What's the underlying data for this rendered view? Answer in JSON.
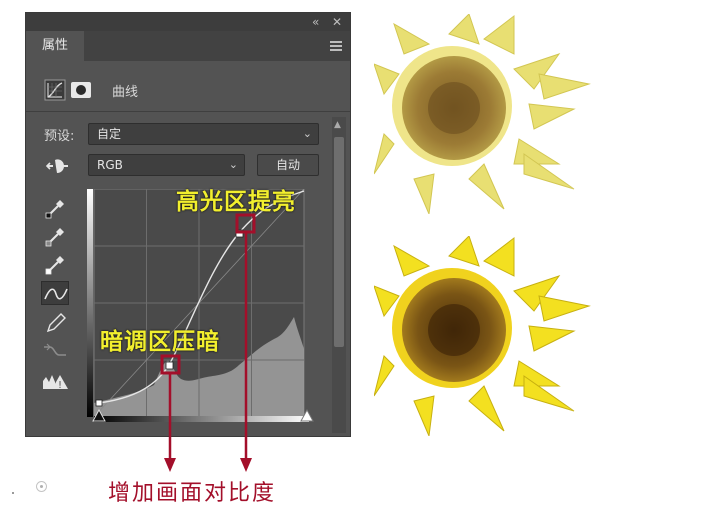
{
  "panel": {
    "tab_label": "属性",
    "collapse_icon": "double-chevron-left-icon",
    "close_icon": "close-icon",
    "menu_icon": "panel-menu-icon",
    "adjustment_label": "曲线",
    "preset_label": "预设:",
    "preset_value": "自定",
    "channel_value": "RGB",
    "auto_button": "自动"
  },
  "tools": [
    {
      "name": "on-image-adjust-icon"
    },
    {
      "name": "black-point-eyedropper-icon"
    },
    {
      "name": "gray-point-eyedropper-icon"
    },
    {
      "name": "white-point-eyedropper-icon"
    },
    {
      "name": "edit-curve-points-icon"
    },
    {
      "name": "pencil-draw-icon"
    },
    {
      "name": "smooth-curve-icon"
    },
    {
      "name": "clipping-warning-icon"
    }
  ],
  "annotations": {
    "highlight": "高光区提亮",
    "shadow": "暗调区压暗",
    "result": "增加画面对比度"
  },
  "colors": {
    "annotation_yellow": "#f2ef2e",
    "marker_red": "#a30f2a",
    "panel_bg": "#535353"
  }
}
